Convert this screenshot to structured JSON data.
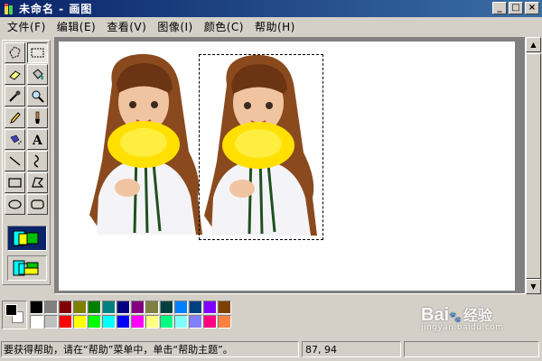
{
  "window": {
    "title": "未命名 - 画图",
    "min": "_",
    "max": "□",
    "close": "×"
  },
  "menu": [
    "文件(F)",
    "编辑(E)",
    "查看(V)",
    "图像(I)",
    "颜色(C)",
    "帮助(H)"
  ],
  "tools": [
    {
      "name": "free-select-tool-icon"
    },
    {
      "name": "rect-select-tool-icon",
      "pressed": true
    },
    {
      "name": "eraser-tool-icon"
    },
    {
      "name": "fill-tool-icon"
    },
    {
      "name": "pick-color-tool-icon"
    },
    {
      "name": "magnifier-tool-icon"
    },
    {
      "name": "pencil-tool-icon"
    },
    {
      "name": "brush-tool-icon"
    },
    {
      "name": "airbrush-tool-icon"
    },
    {
      "name": "text-tool-icon",
      "glyph": "A"
    },
    {
      "name": "line-tool-icon"
    },
    {
      "name": "curve-tool-icon"
    },
    {
      "name": "rectangle-tool-icon"
    },
    {
      "name": "polygon-tool-icon"
    },
    {
      "name": "ellipse-tool-icon"
    },
    {
      "name": "rounded-rect-tool-icon"
    }
  ],
  "palette": {
    "foreground": "#000000",
    "background": "#ffffff",
    "row1": [
      "#000000",
      "#808080",
      "#800000",
      "#808000",
      "#008000",
      "#008080",
      "#000080",
      "#800080",
      "#808040",
      "#004040",
      "#0080ff",
      "#004080",
      "#8000ff",
      "#804000"
    ],
    "row2": [
      "#ffffff",
      "#c0c0c0",
      "#ff0000",
      "#ffff00",
      "#00ff00",
      "#00ffff",
      "#0000ff",
      "#ff00ff",
      "#ffff80",
      "#00ff80",
      "#80ffff",
      "#8080ff",
      "#ff0080",
      "#ff8040"
    ]
  },
  "status": {
    "help_text": "要获得帮助，请在“帮助”菜单中，单击“帮助主题”。",
    "coords": "87, 94"
  },
  "watermark": {
    "main": "Bai",
    "cn": "经验",
    "sub": "jingyan.baidu.com"
  }
}
